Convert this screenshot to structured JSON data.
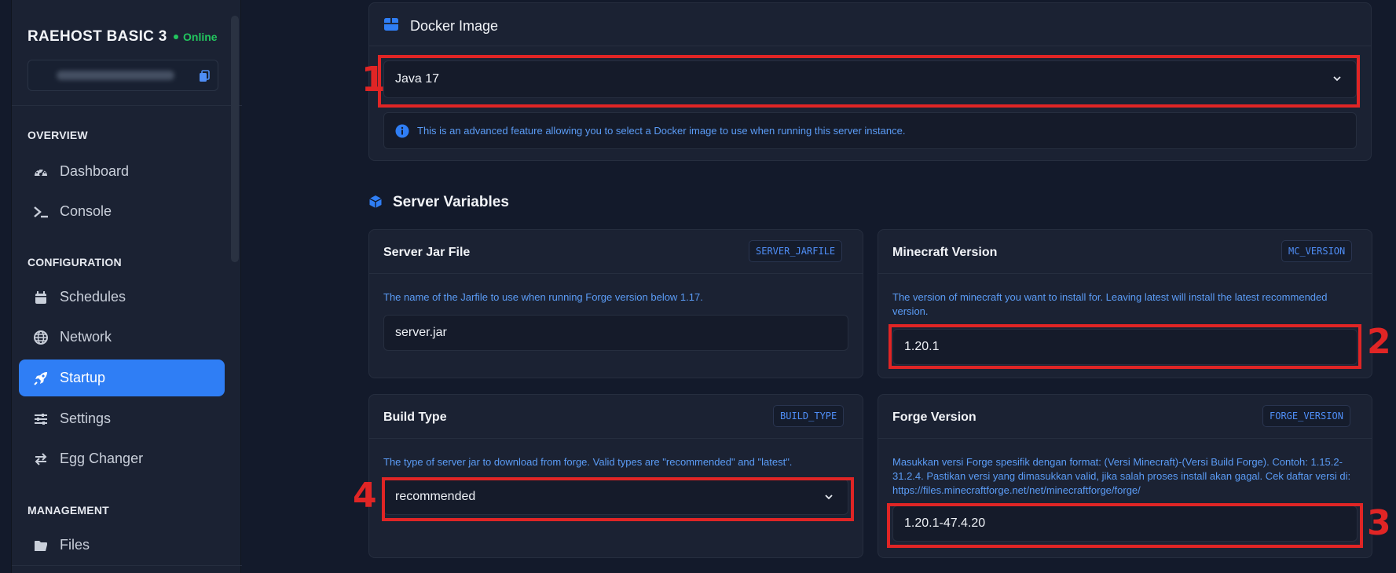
{
  "sidebar": {
    "server_name": "RAEHOST BASIC 3",
    "status": "Online",
    "sections": {
      "overview": "OVERVIEW",
      "configuration": "CONFIGURATION",
      "management": "MANAGEMENT"
    },
    "items": [
      {
        "label": "Dashboard",
        "icon": "gauge-icon"
      },
      {
        "label": "Console",
        "icon": "terminal-icon"
      },
      {
        "label": "Schedules",
        "icon": "calendar-icon"
      },
      {
        "label": "Network",
        "icon": "globe-icon"
      },
      {
        "label": "Startup",
        "icon": "rocket-icon",
        "active": true
      },
      {
        "label": "Settings",
        "icon": "sliders-icon"
      },
      {
        "label": "Egg Changer",
        "icon": "swap-icon"
      },
      {
        "label": "Files",
        "icon": "folder-icon"
      }
    ]
  },
  "docker": {
    "title": "Docker Image",
    "selected": "Java 17",
    "info": "This is an advanced feature allowing you to select a Docker image to use when running this server instance."
  },
  "server_variables": {
    "title": "Server Variables",
    "vars": [
      {
        "title": "Server Jar File",
        "tag": "SERVER_JARFILE",
        "desc": "The name of the Jarfile to use when running Forge version below 1.17.",
        "value": "server.jar"
      },
      {
        "title": "Minecraft Version",
        "tag": "MC_VERSION",
        "desc": "The version of minecraft you want to install for. Leaving latest will install the latest recommended version.",
        "value": "1.20.1"
      },
      {
        "title": "Build Type",
        "tag": "BUILD_TYPE",
        "desc": "The type of server jar to download from forge. Valid types are \"recommended\" and \"latest\".",
        "value": "recommended"
      },
      {
        "title": "Forge Version",
        "tag": "FORGE_VERSION",
        "desc": "Masukkan versi Forge spesifik dengan format: (Versi Minecraft)-(Versi Build Forge). Contoh: 1.15.2-31.2.4. Pastikan versi yang dimasukkan valid, jika salah proses install akan gagal. Cek daftar versi di: https://files.minecraftforge.net/net/minecraftforge/forge/",
        "value": "1.20.1-47.4.20"
      }
    ]
  },
  "annotations": [
    "1",
    "2",
    "3",
    "4"
  ],
  "colors": {
    "accent": "#2f7ef5",
    "online": "#22c55e",
    "annotation": "#e02525",
    "link_text": "#5b9cf6"
  }
}
